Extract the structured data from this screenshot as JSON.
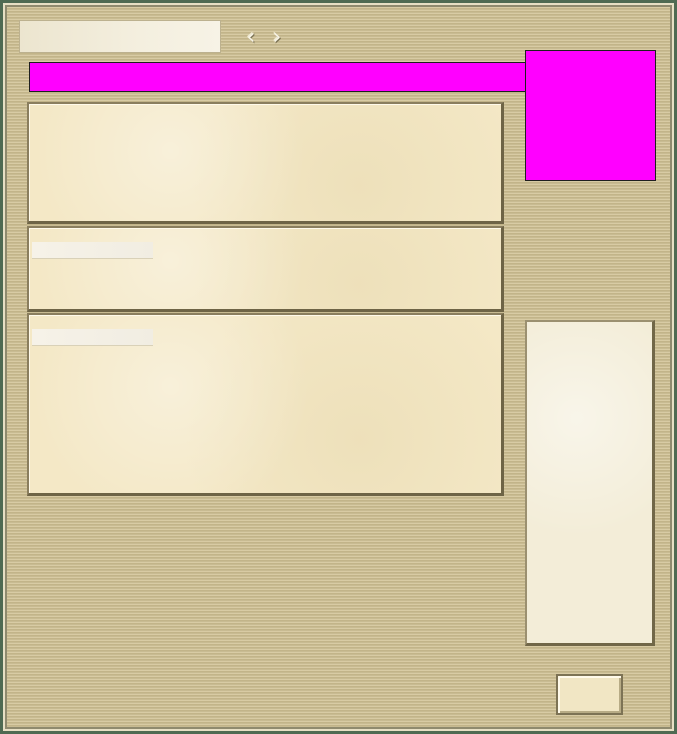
{
  "window": {
    "title_field": ""
  },
  "nav": {
    "prev_icon": "chevron-left-icon",
    "next_icon": "chevron-right-icon"
  },
  "colors": {
    "placeholder_magenta": "#ff00ff",
    "frame_green": "#4f6a52",
    "parchment": "#f4e8c6"
  },
  "panels": {
    "top": {
      "text": ""
    },
    "middle": {
      "label": ""
    },
    "bottom": {
      "label": ""
    }
  },
  "side_panel": {
    "text": ""
  },
  "ok_button": {
    "label": ""
  }
}
